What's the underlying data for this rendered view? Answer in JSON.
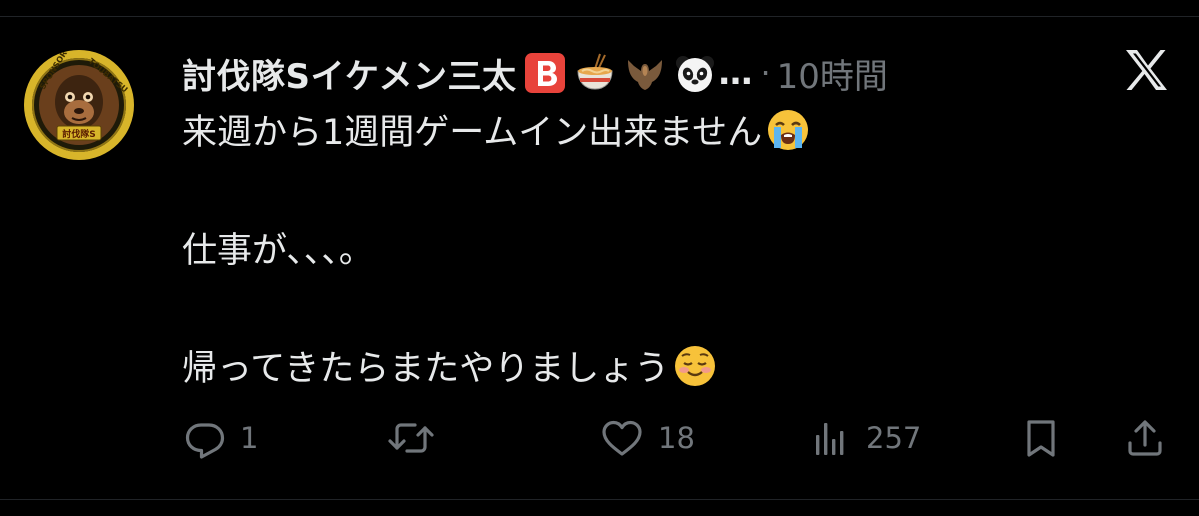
{
  "tweet": {
    "display_name": "討伐隊Sイケメン三太",
    "name_emojis": [
      "b-button-icon",
      "noodle-bowl-icon",
      "bat-icon",
      "panda-icon"
    ],
    "ellipsis": "…",
    "dot": "·",
    "time": "10時間",
    "lines": [
      "来週から1週間ゲームイン出来ません",
      "仕事が、、、。",
      "帰ってきたらまたやりましょう"
    ],
    "line_emojis": [
      "loudly-crying-face-icon",
      "",
      "smiling-face-icon"
    ]
  },
  "avatar": {
    "badge_top": "SPONSOR",
    "badge_top_right": "TOUBATSUTAI",
    "badge_bottom": "討伐隊S"
  },
  "actions": {
    "reply_count": "1",
    "repost_count": "",
    "like_count": "18",
    "views_count": "257"
  },
  "colors": {
    "background": "#000000",
    "text": "#e7e9ea",
    "muted": "#71767b",
    "divider": "#202327",
    "badge_gold": "#d8b52a"
  }
}
